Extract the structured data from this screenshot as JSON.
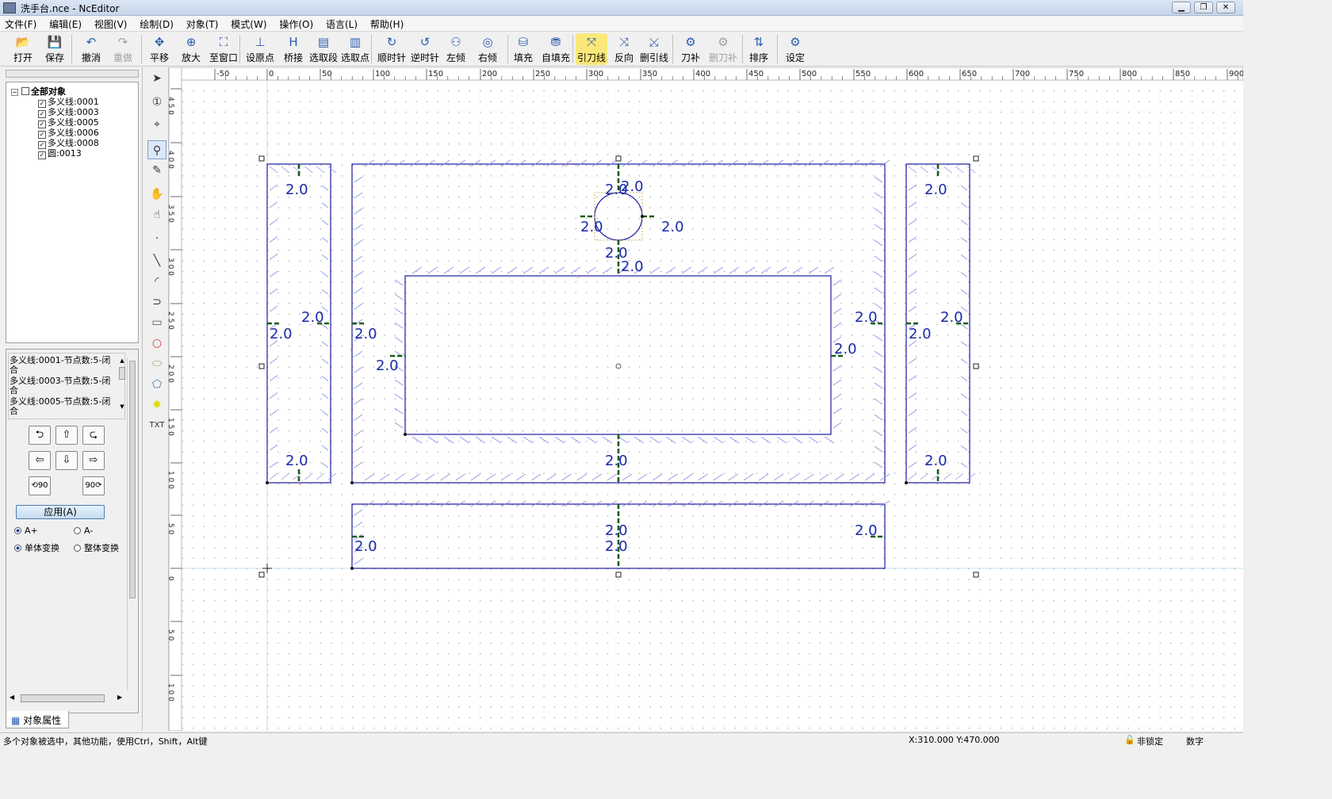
{
  "window": {
    "title": "洗手台.nce - NcEditor"
  },
  "menu": [
    "文件(F)",
    "编辑(E)",
    "视图(V)",
    "绘制(D)",
    "对象(T)",
    "模式(W)",
    "操作(O)",
    "语言(L)",
    "帮助(H)"
  ],
  "toolbar": [
    {
      "label": "打开",
      "icon": "open-folder-icon"
    },
    {
      "label": "保存",
      "icon": "save-disk-icon"
    },
    {
      "label": "撤消",
      "icon": "undo-icon"
    },
    {
      "label": "重做",
      "icon": "redo-icon",
      "disabled": true
    },
    {
      "label": "平移",
      "icon": "pan-move-icon"
    },
    {
      "label": "放大",
      "icon": "zoom-in-icon"
    },
    {
      "label": "至窗口",
      "icon": "fit-window-icon"
    },
    {
      "label": "设原点",
      "icon": "set-origin-icon"
    },
    {
      "label": "桥接",
      "icon": "bridge-icon"
    },
    {
      "label": "选取段",
      "icon": "select-segment-icon"
    },
    {
      "label": "选取点",
      "icon": "select-point-icon"
    },
    {
      "label": "顺时针",
      "icon": "clockwise-icon"
    },
    {
      "label": "逆时针",
      "icon": "counterclockwise-icon"
    },
    {
      "label": "左倾",
      "icon": "lean-left-icon"
    },
    {
      "label": "右倾",
      "icon": "lean-right-icon"
    },
    {
      "label": "填充",
      "icon": "fill-icon"
    },
    {
      "label": "自填充",
      "icon": "auto-fill-icon"
    },
    {
      "label": "引刀线",
      "icon": "lead-line-icon",
      "highlighted": true
    },
    {
      "label": "反向",
      "icon": "reverse-icon"
    },
    {
      "label": "删引线",
      "icon": "delete-lead-icon"
    },
    {
      "label": "刀补",
      "icon": "tool-comp-icon"
    },
    {
      "label": "删刀补",
      "icon": "delete-comp-icon",
      "disabled": true
    },
    {
      "label": "排序",
      "icon": "sort-icon"
    },
    {
      "label": "设定",
      "icon": "settings-gear-icon"
    }
  ],
  "tree": {
    "root": "全部对象",
    "items": [
      "多义线:0001",
      "多义线:0003",
      "多义线:0005",
      "多义线:0006",
      "多义线:0008",
      "圆:0013"
    ]
  },
  "props": {
    "list": [
      "多义线:0001-节点数:5-闭合",
      "多义线:0003-节点数:5-闭合",
      "多义线:0005-节点数:5-闭合"
    ],
    "apply": "应用(A)",
    "radio_a_plus": "A+",
    "radio_a_minus": "A-",
    "radio_single": "单体变换",
    "radio_whole": "整体变换",
    "tab": "对象属性"
  },
  "ruler": {
    "h": [
      "-50",
      "0",
      "50",
      "100",
      "150",
      "200",
      "250",
      "300",
      "350",
      "400",
      "450",
      "500",
      "550",
      "600",
      "650",
      "700",
      "750",
      "800",
      "850",
      "900"
    ],
    "v": [
      "450",
      "400",
      "350",
      "300",
      "250",
      "200",
      "150",
      "100",
      "50",
      "0",
      "50",
      "100"
    ]
  },
  "lead_label": "2.0",
  "status": {
    "message": "多个对象被选中，其他功能，使用Ctrl，Shift，Alt键",
    "coords": "X:310.000  Y:470.000",
    "lock": "非锁定",
    "mode": "数字"
  },
  "colors": {
    "shape": "#1a1aa0",
    "lead": "#1a5c1a",
    "hatch": "#8f8fe0",
    "label": "#1a2aa8",
    "highlight": "#fbe87a"
  }
}
